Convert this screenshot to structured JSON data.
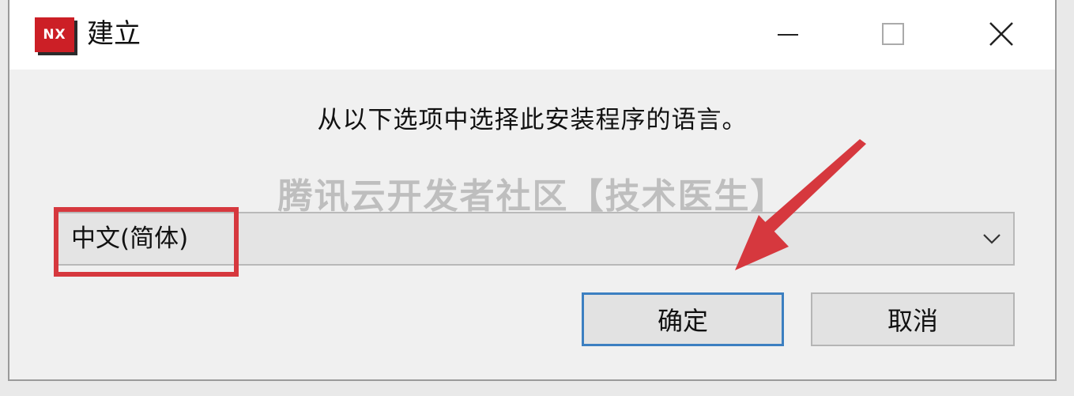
{
  "window": {
    "title": "建立",
    "app_logo_text": "NX"
  },
  "dialog": {
    "prompt": "从以下选项中选择此安装程序的语言。",
    "language_select": {
      "selected": "中文(简体)"
    },
    "buttons": {
      "ok_label": "确定",
      "cancel_label": "取消"
    }
  },
  "watermark": "腾讯云开发者社区【技术医生】",
  "colors": {
    "accent_border": "#3c7fc1",
    "annotation_red": "#d6383e",
    "logo_red": "#cc1f26"
  },
  "icons": {
    "minimize": "minimize-icon",
    "maximize": "maximize-icon",
    "close": "close-icon",
    "dropdown": "chevron-down-icon"
  }
}
